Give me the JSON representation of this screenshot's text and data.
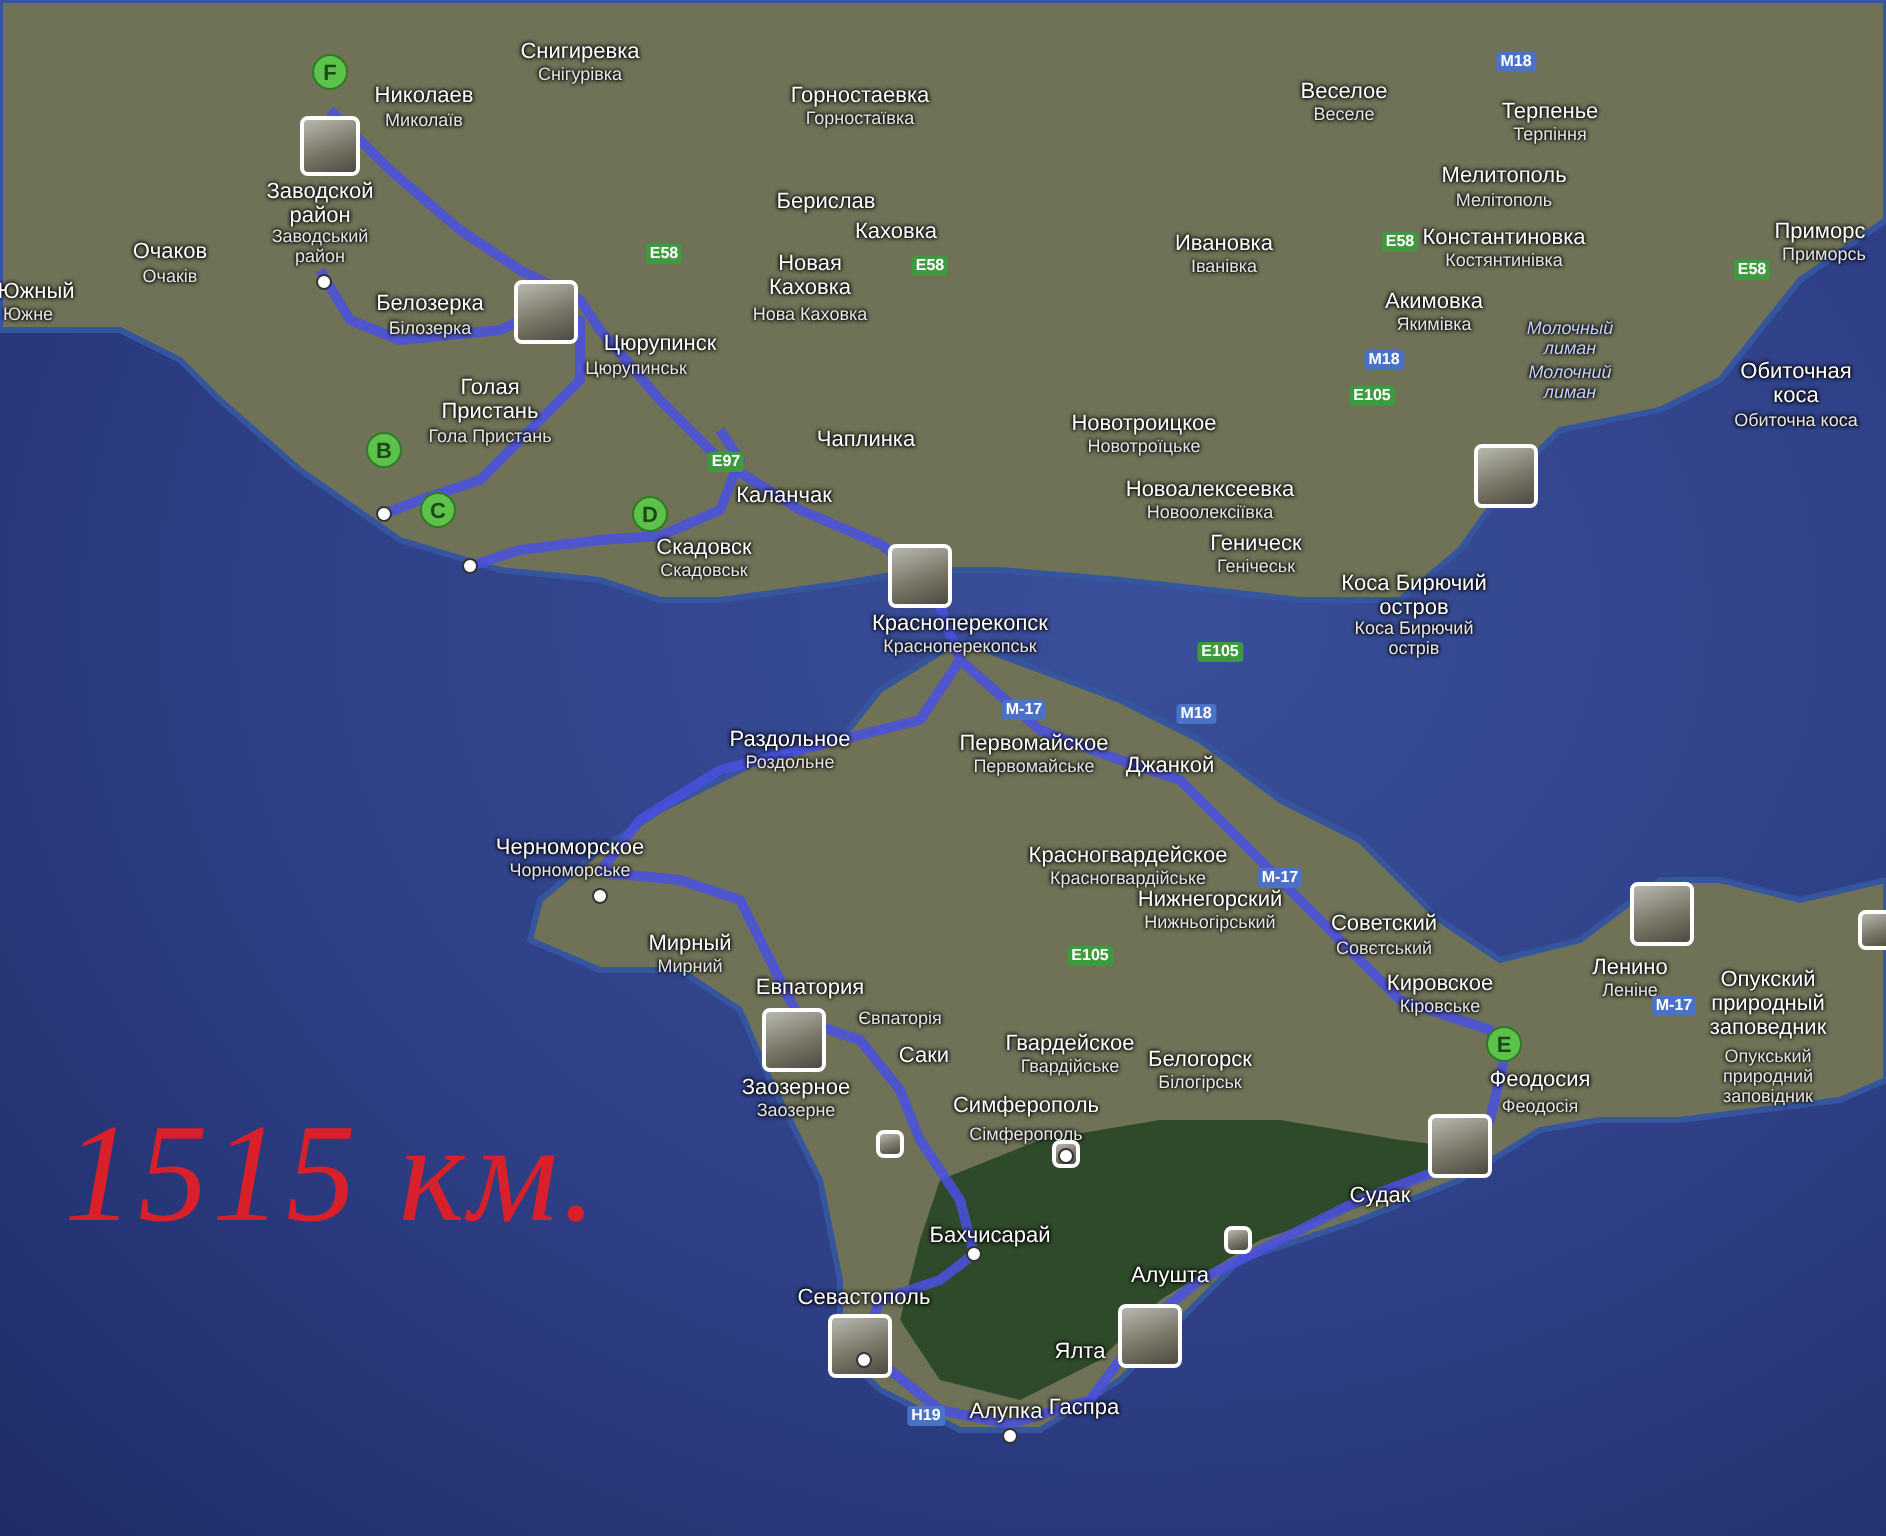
{
  "map": {
    "labels": [
      {
        "text": "Снигиревка",
        "kind": "name"
      },
      {
        "text": "Снігурівка",
        "kind": "local"
      },
      {
        "text": "Николаев",
        "kind": "name"
      },
      {
        "text": "Миколаїв",
        "kind": "local"
      },
      {
        "text": "Заводской район",
        "kind": "name"
      },
      {
        "text": "Очаков",
        "kind": "name"
      },
      {
        "text": "Очаків",
        "kind": "local"
      },
      {
        "text": "Заводський район",
        "kind": "local"
      },
      {
        "text": "Южный",
        "kind": "name"
      },
      {
        "text": "Южне",
        "kind": "local"
      },
      {
        "text": "Белозерка",
        "kind": "name"
      },
      {
        "text": "Білозерка",
        "kind": "local"
      },
      {
        "text": "Цюрупинск",
        "kind": "name"
      },
      {
        "text": "Цюрупинськ",
        "kind": "local"
      },
      {
        "text": "Голая Пристань",
        "kind": "name"
      },
      {
        "text": "Гола Пристань",
        "kind": "local"
      },
      {
        "text": "Скадовск",
        "kind": "name"
      },
      {
        "text": "Скадовськ",
        "kind": "local"
      },
      {
        "text": "Каланчак",
        "kind": "name"
      },
      {
        "text": "Горностаевка",
        "kind": "name"
      },
      {
        "text": "Горностаївка",
        "kind": "local"
      },
      {
        "text": "Берислав",
        "kind": "name"
      },
      {
        "text": "Каховка",
        "kind": "name"
      },
      {
        "text": "Новая Каховка",
        "kind": "name"
      },
      {
        "text": "Нова Каховка",
        "kind": "local"
      },
      {
        "text": "Чаплинка",
        "kind": "name"
      },
      {
        "text": "Ивановка",
        "kind": "name"
      },
      {
        "text": "Іванівка",
        "kind": "local"
      },
      {
        "text": "Новотроицкое",
        "kind": "name"
      },
      {
        "text": "Новотроїцьке",
        "kind": "local"
      },
      {
        "text": "Новоалексеевка",
        "kind": "name"
      },
      {
        "text": "Новоолексіївка",
        "kind": "local"
      },
      {
        "text": "Геническ",
        "kind": "name"
      },
      {
        "text": "Генічеськ",
        "kind": "local"
      },
      {
        "text": "Красноперекопск",
        "kind": "name"
      },
      {
        "text": "Красноперекопськ",
        "kind": "local"
      },
      {
        "text": "Веселое",
        "kind": "name"
      },
      {
        "text": "Веселе",
        "kind": "local"
      },
      {
        "text": "Терпенье",
        "kind": "name"
      },
      {
        "text": "Терпіння",
        "kind": "local"
      },
      {
        "text": "Мелитополь",
        "kind": "name"
      },
      {
        "text": "Мелітополь",
        "kind": "local"
      },
      {
        "text": "Константиновка",
        "kind": "name"
      },
      {
        "text": "Костянтинівка",
        "kind": "local"
      },
      {
        "text": "Акимовка",
        "kind": "name"
      },
      {
        "text": "Якимівка",
        "kind": "local"
      },
      {
        "text": "Молочный лиман",
        "kind": "water"
      },
      {
        "text": "Молочний лиман",
        "kind": "water"
      },
      {
        "text": "Приморс",
        "kind": "name"
      },
      {
        "text": "Приморсь",
        "kind": "local"
      },
      {
        "text": "Обиточная коса",
        "kind": "name"
      },
      {
        "text": "Обиточна коса",
        "kind": "local"
      },
      {
        "text": "Коса Бирючий остров",
        "kind": "name"
      },
      {
        "text": "Коса Бирючий острів",
        "kind": "local"
      },
      {
        "text": "Раздольное",
        "kind": "name"
      },
      {
        "text": "Роздольне",
        "kind": "local"
      },
      {
        "text": "Первомайское",
        "kind": "name"
      },
      {
        "text": "Первомайське",
        "kind": "local"
      },
      {
        "text": "Джанкой",
        "kind": "name"
      },
      {
        "text": "Черноморское",
        "kind": "name"
      },
      {
        "text": "Чорноморське",
        "kind": "local"
      },
      {
        "text": "Красногвардейское",
        "kind": "name"
      },
      {
        "text": "Красногвардійське",
        "kind": "local"
      },
      {
        "text": "Нижнегорский",
        "kind": "name"
      },
      {
        "text": "Нижньогірський",
        "kind": "local"
      },
      {
        "text": "Советский",
        "kind": "name"
      },
      {
        "text": "Совєтський",
        "kind": "local"
      },
      {
        "text": "Кировское",
        "kind": "name"
      },
      {
        "text": "Кіровське",
        "kind": "local"
      },
      {
        "text": "Ленино",
        "kind": "name"
      },
      {
        "text": "Леніне",
        "kind": "local"
      },
      {
        "text": "Опукский природный заповедник",
        "kind": "name"
      },
      {
        "text": "Опукський природний заповідник",
        "kind": "local"
      },
      {
        "text": "Мирный",
        "kind": "name"
      },
      {
        "text": "Мирний",
        "kind": "local"
      },
      {
        "text": "Евпатория",
        "kind": "name"
      },
      {
        "text": "Євпаторія",
        "kind": "local"
      },
      {
        "text": "Заозерное",
        "kind": "name"
      },
      {
        "text": "Заозерне",
        "kind": "local"
      },
      {
        "text": "Саки",
        "kind": "name"
      },
      {
        "text": "Гвардейское",
        "kind": "name"
      },
      {
        "text": "Гвардійське",
        "kind": "local"
      },
      {
        "text": "Белогорск",
        "kind": "name"
      },
      {
        "text": "Білогірськ",
        "kind": "local"
      },
      {
        "text": "Симферополь",
        "kind": "name"
      },
      {
        "text": "Сімферополь",
        "kind": "local"
      },
      {
        "text": "Феодосия",
        "kind": "name"
      },
      {
        "text": "Феодосія",
        "kind": "local"
      },
      {
        "text": "Судак",
        "kind": "name"
      },
      {
        "text": "Бахчисарай",
        "kind": "name"
      },
      {
        "text": "Алушта",
        "kind": "name"
      },
      {
        "text": "Севастополь",
        "kind": "name"
      },
      {
        "text": "Ялта",
        "kind": "name"
      },
      {
        "text": "Алупка",
        "kind": "name"
      },
      {
        "text": "Гаспра",
        "kind": "name"
      }
    ],
    "road_shields": [
      {
        "text": "E58",
        "kind": "european"
      },
      {
        "text": "E58",
        "kind": "european"
      },
      {
        "text": "E58",
        "kind": "european"
      },
      {
        "text": "E58",
        "kind": "european"
      },
      {
        "text": "M18",
        "kind": "national"
      },
      {
        "text": "M18",
        "kind": "national"
      },
      {
        "text": "E105",
        "kind": "european"
      },
      {
        "text": "E97",
        "kind": "european"
      },
      {
        "text": "E105",
        "kind": "european"
      },
      {
        "text": "M-17",
        "kind": "national"
      },
      {
        "text": "M18",
        "kind": "national"
      },
      {
        "text": "E105",
        "kind": "european"
      },
      {
        "text": "M-17",
        "kind": "national"
      },
      {
        "text": "M-17",
        "kind": "national"
      },
      {
        "text": "H19",
        "kind": "national"
      }
    ],
    "markers": [
      {
        "letter": "F"
      },
      {
        "letter": "B"
      },
      {
        "letter": "C"
      },
      {
        "letter": "D"
      },
      {
        "letter": "E"
      }
    ],
    "annotation": "1515 км."
  }
}
